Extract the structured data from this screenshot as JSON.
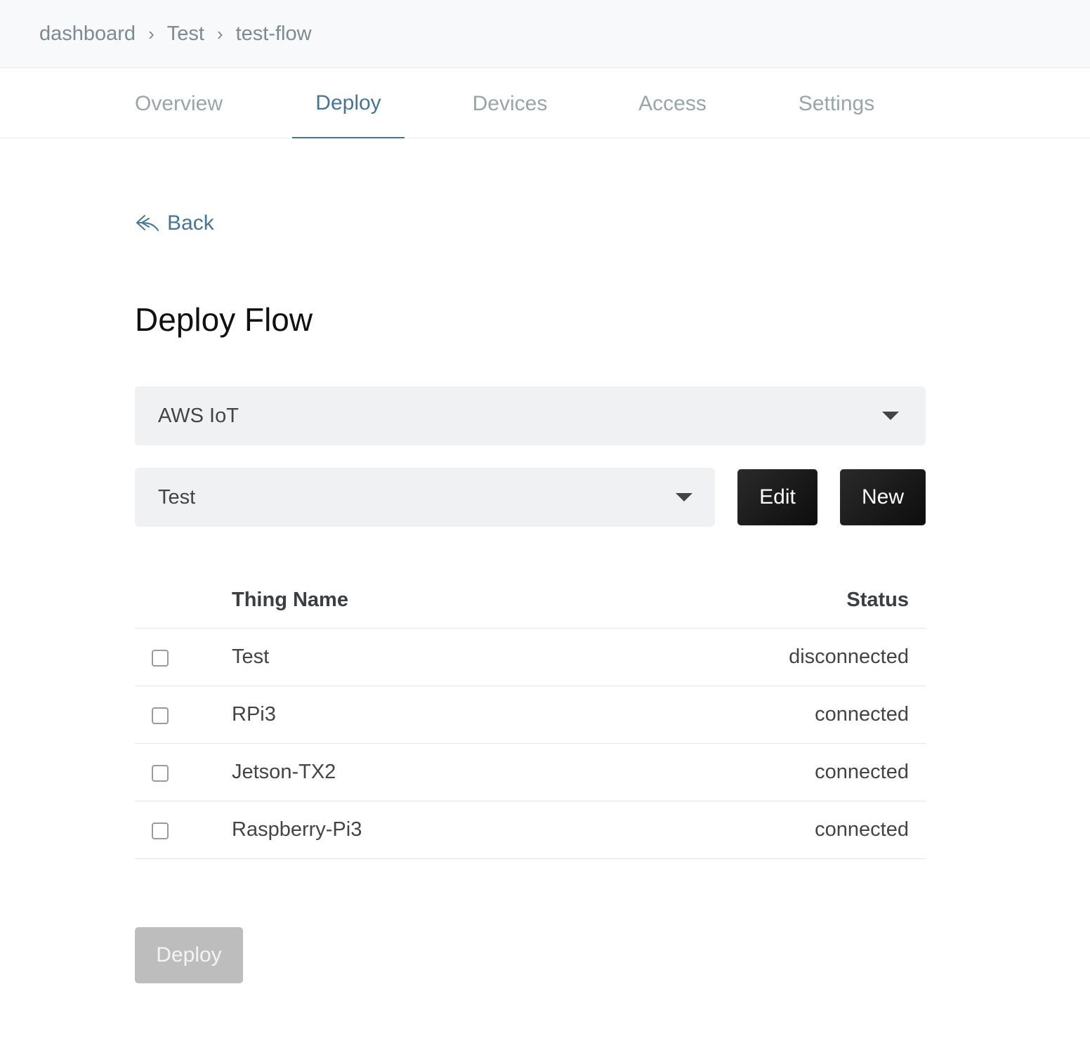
{
  "breadcrumb": {
    "items": [
      "dashboard",
      "Test",
      "test-flow"
    ],
    "separator": "›"
  },
  "tabs": [
    {
      "label": "Overview",
      "active": false
    },
    {
      "label": "Deploy",
      "active": true
    },
    {
      "label": "Devices",
      "active": false
    },
    {
      "label": "Access",
      "active": false
    },
    {
      "label": "Settings",
      "active": false
    }
  ],
  "back": {
    "label": "Back",
    "icon": "reply-arrow-icon"
  },
  "page": {
    "title": "Deploy Flow"
  },
  "provider_select": {
    "value": "AWS IoT",
    "icon": "caret-down-icon"
  },
  "group_select": {
    "value": "Test",
    "icon": "caret-down-icon"
  },
  "buttons": {
    "edit": "Edit",
    "new": "New",
    "deploy": "Deploy"
  },
  "table": {
    "headers": {
      "name": "Thing Name",
      "status": "Status"
    },
    "rows": [
      {
        "name": "Test",
        "status": "disconnected",
        "checked": false
      },
      {
        "name": "RPi3",
        "status": "connected",
        "checked": false
      },
      {
        "name": "Jetson-TX2",
        "status": "connected",
        "checked": false
      },
      {
        "name": "Raspberry-Pi3",
        "status": "connected",
        "checked": false
      }
    ]
  },
  "colors": {
    "accent": "#4a7494",
    "muted": "#9aa4ab",
    "button_dark": "#1a1a1a",
    "button_disabled": "#bdbdbd"
  }
}
